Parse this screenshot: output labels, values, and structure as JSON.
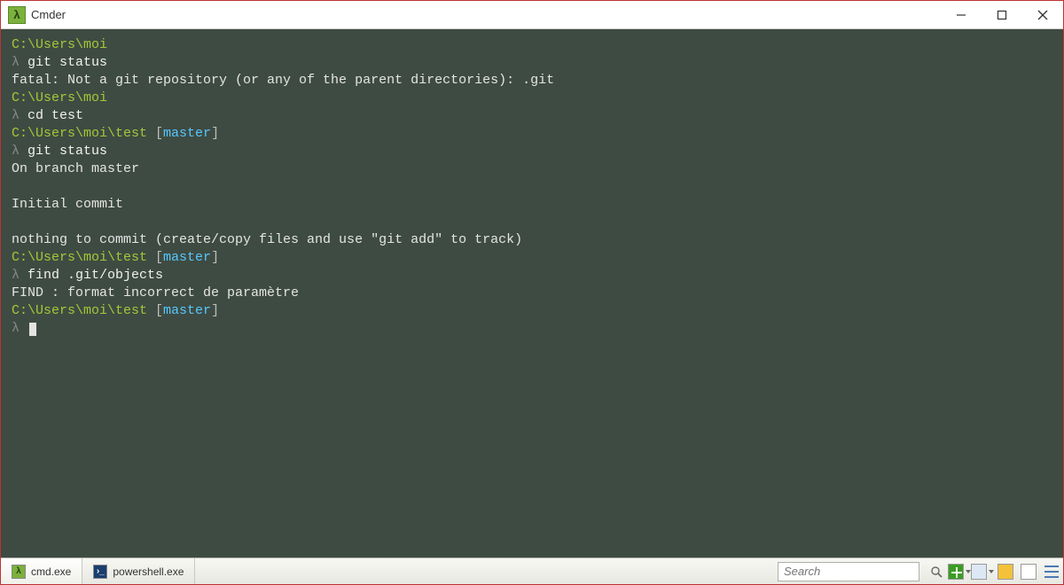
{
  "window": {
    "title": "Cmder",
    "icon_glyph": "λ"
  },
  "terminal": {
    "lines": [
      {
        "path": "C:\\Users\\moi"
      },
      {
        "prompt": "λ",
        "cmd": "git status"
      },
      {
        "out": "fatal: Not a git repository (or any of the parent directories): .git"
      },
      {
        "path": "C:\\Users\\moi"
      },
      {
        "prompt": "λ",
        "cmd": "cd test"
      },
      {
        "path": "C:\\Users\\moi\\test",
        "branch": "master"
      },
      {
        "prompt": "λ",
        "cmd": "git status"
      },
      {
        "out": "On branch master"
      },
      {
        "out": ""
      },
      {
        "out": "Initial commit"
      },
      {
        "out": ""
      },
      {
        "out": "nothing to commit (create/copy files and use \"git add\" to track)"
      },
      {
        "path": "C:\\Users\\moi\\test",
        "branch": "master"
      },
      {
        "prompt": "λ",
        "cmd": "find .git/objects"
      },
      {
        "out": "FIND : format incorrect de paramètre"
      },
      {
        "path": "C:\\Users\\moi\\test",
        "branch": "master"
      },
      {
        "prompt": "λ",
        "cursor": true
      }
    ]
  },
  "tabs": [
    {
      "label": "cmd.exe",
      "icon": "lam",
      "active": true
    },
    {
      "label": "powershell.exe",
      "icon": "ps",
      "active": false
    }
  ],
  "search": {
    "placeholder": "Search"
  }
}
